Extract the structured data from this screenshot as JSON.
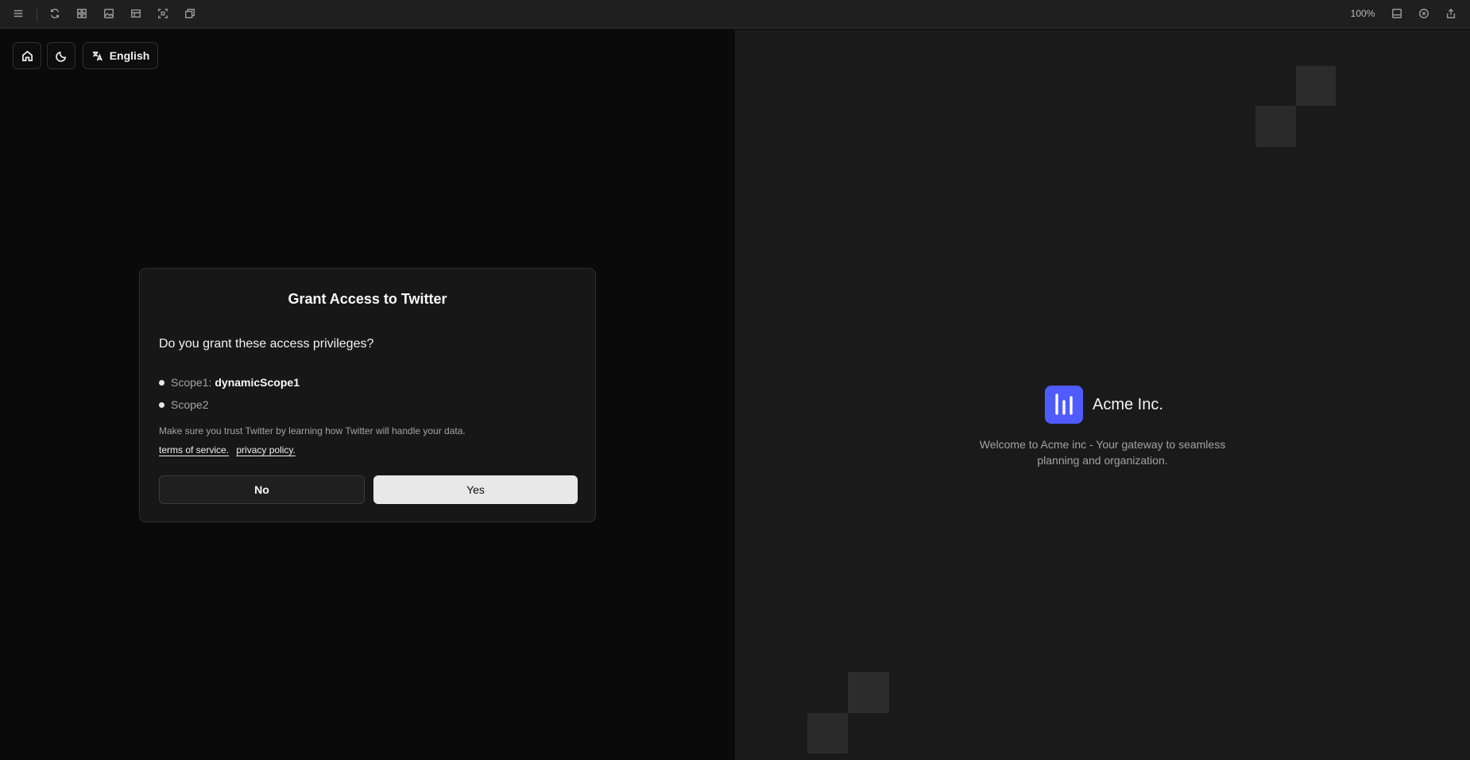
{
  "toolbar": {
    "icons": [
      "menu-icon",
      "refresh-icon",
      "grid-icon",
      "image-icon",
      "layout-icon",
      "selection-icon",
      "copy-icon"
    ],
    "zoom": "100%",
    "right_icons": [
      "panel-icon",
      "close-circle-icon",
      "share-icon"
    ]
  },
  "controls": {
    "language": "English"
  },
  "dialog": {
    "title": "Grant Access to Twitter",
    "question": "Do you grant these access privileges?",
    "scopes": [
      {
        "label": "Scope1:",
        "value": "dynamicScope1"
      },
      {
        "label": "Scope2",
        "value": ""
      }
    ],
    "trust_text": "Make sure you trust Twitter by learning how Twitter will handle your data.",
    "terms_link": "terms of service.",
    "privacy_link": "privacy policy.",
    "no_label": "No",
    "yes_label": "Yes"
  },
  "brand": {
    "name": "Acme Inc.",
    "welcome": "Welcome to Acme inc - Your gateway to seamless planning and organization.",
    "accent_color": "#4f5bff"
  }
}
